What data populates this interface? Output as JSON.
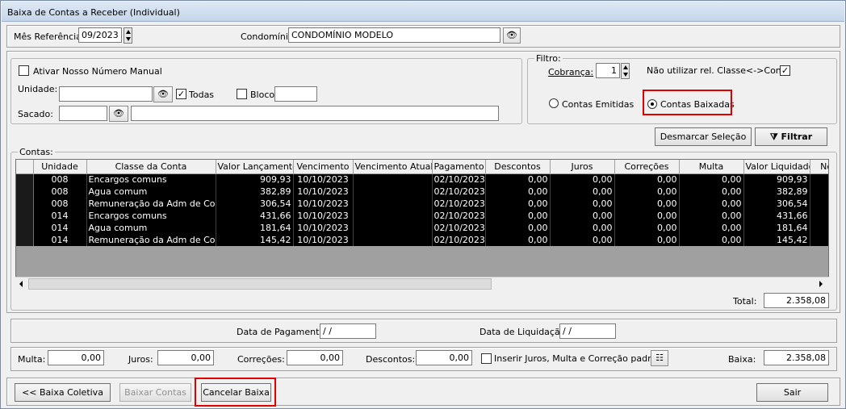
{
  "window": {
    "title": "Baixa de Contas a Receber (Individual)"
  },
  "header": {
    "mes_label": "Mês Referência:",
    "mes_value": "09/2023",
    "condominio_label": "Condomínio:",
    "condominio_value": "CONDOMÍNIO MODELO"
  },
  "left": {
    "nosso_numero_label": "Ativar Nosso Número Manual",
    "unidade_label": "Unidade:",
    "unidade_value": "",
    "todas_label": "Todas",
    "bloco_label": "Bloco",
    "bloco_value": "",
    "sacado_label": "Sacado:",
    "sacado_code": "",
    "sacado_name": ""
  },
  "filtro": {
    "caption": "Filtro:",
    "cobranca_label": "Cobrança:",
    "cobranca_value": "1",
    "nao_utilizar_label": "Não utilizar rel. Classe<->Conta",
    "emitidas_label": "Contas Emitidas",
    "baixadas_label": "Contas Baixadas"
  },
  "actions": {
    "desmarcar": "Desmarcar Seleção",
    "filtrar": "Filtrar"
  },
  "contas": {
    "caption": "Contas:",
    "columns": [
      "Unidade",
      "Classe da Conta",
      "Valor Lançamento",
      "Vencimento",
      "Vencimento Atual",
      "Pagamento",
      "Descontos",
      "Juros",
      "Correções",
      "Multa",
      "Valor Liquidado",
      "Nos"
    ],
    "rows": [
      [
        "008",
        "Encargos comuns",
        "909,93",
        "10/10/2023",
        "",
        "02/10/2023",
        "0,00",
        "0,00",
        "0,00",
        "0,00",
        "909,93",
        ""
      ],
      [
        "008",
        "Agua comum",
        "382,89",
        "10/10/2023",
        "",
        "02/10/2023",
        "0,00",
        "0,00",
        "0,00",
        "0,00",
        "382,89",
        ""
      ],
      [
        "008",
        "Remuneração da Adm de Condor",
        "306,54",
        "10/10/2023",
        "",
        "02/10/2023",
        "0,00",
        "0,00",
        "0,00",
        "0,00",
        "306,54",
        ""
      ],
      [
        "014",
        "Encargos comuns",
        "431,66",
        "10/10/2023",
        "",
        "02/10/2023",
        "0,00",
        "0,00",
        "0,00",
        "0,00",
        "431,66",
        ""
      ],
      [
        "014",
        "Agua comum",
        "181,64",
        "10/10/2023",
        "",
        "02/10/2023",
        "0,00",
        "0,00",
        "0,00",
        "0,00",
        "181,64",
        ""
      ],
      [
        "014",
        "Remuneração da Adm de Condor",
        "145,42",
        "10/10/2023",
        "",
        "02/10/2023",
        "0,00",
        "0,00",
        "0,00",
        "0,00",
        "145,42",
        ""
      ]
    ],
    "total_label": "Total:",
    "total_value": "2.358,08"
  },
  "datas": {
    "pagamento_label": "Data de Pagamento:",
    "pagamento_value": " / /",
    "liquidacao_label": "Data de Liquidação:",
    "liquidacao_value": " / /"
  },
  "valores": {
    "multa_label": "Multa:",
    "multa_value": "0,00",
    "juros_label": "Juros:",
    "juros_value": "0,00",
    "correcoes_label": "Correções:",
    "correcoes_value": "0,00",
    "descontos_label": "Descontos:",
    "descontos_value": "0,00",
    "inserir_label": "Inserir Juros, Multa e Correção padrão",
    "baixa_label": "Baixa:",
    "baixa_value": "2.358,08"
  },
  "footer": {
    "baixa_coletiva": "<< Baixa Coletiva",
    "baixar_contas": "Baixar Contas",
    "cancelar_baixa": "Cancelar Baixa",
    "sair": "Sair"
  },
  "colors": {
    "highlight": "#e00000",
    "grid_row_bg": "#000000",
    "grid_empty_bg": "#a0a0a0"
  }
}
